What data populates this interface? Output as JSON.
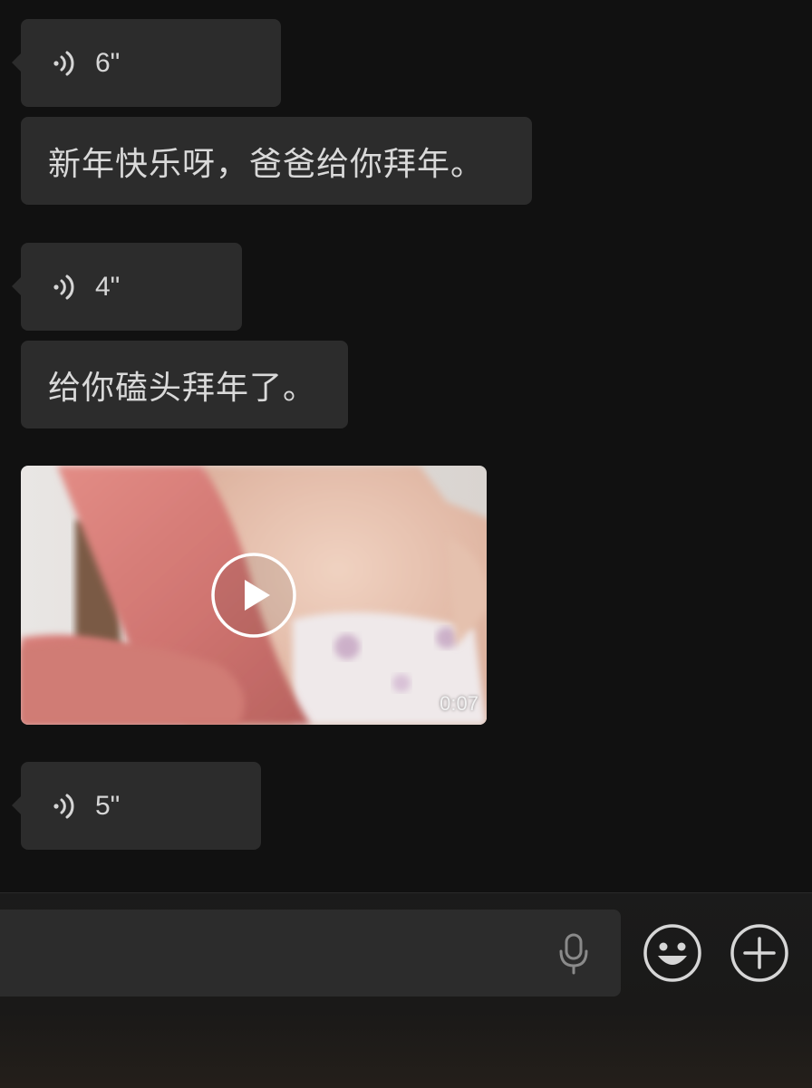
{
  "messages": [
    {
      "type": "voice",
      "duration": "6\""
    },
    {
      "type": "text",
      "text": "新年快乐呀，爸爸给你拜年。"
    },
    {
      "type": "voice",
      "duration": "4\""
    },
    {
      "type": "text",
      "text": "给你磕头拜年了。"
    },
    {
      "type": "video",
      "duration": "0:07"
    },
    {
      "type": "voice",
      "duration": "5\""
    }
  ],
  "input_bar": {
    "voice_icon": "microphone-icon",
    "emoji_icon": "smiley-icon",
    "more_icon": "plus-icon"
  },
  "icons": {
    "voice_message": "sound-wave-icon",
    "video_play": "play-icon"
  },
  "colors": {
    "background": "#111111",
    "bubble": "#2c2c2c",
    "text": "#d9d9d9"
  }
}
